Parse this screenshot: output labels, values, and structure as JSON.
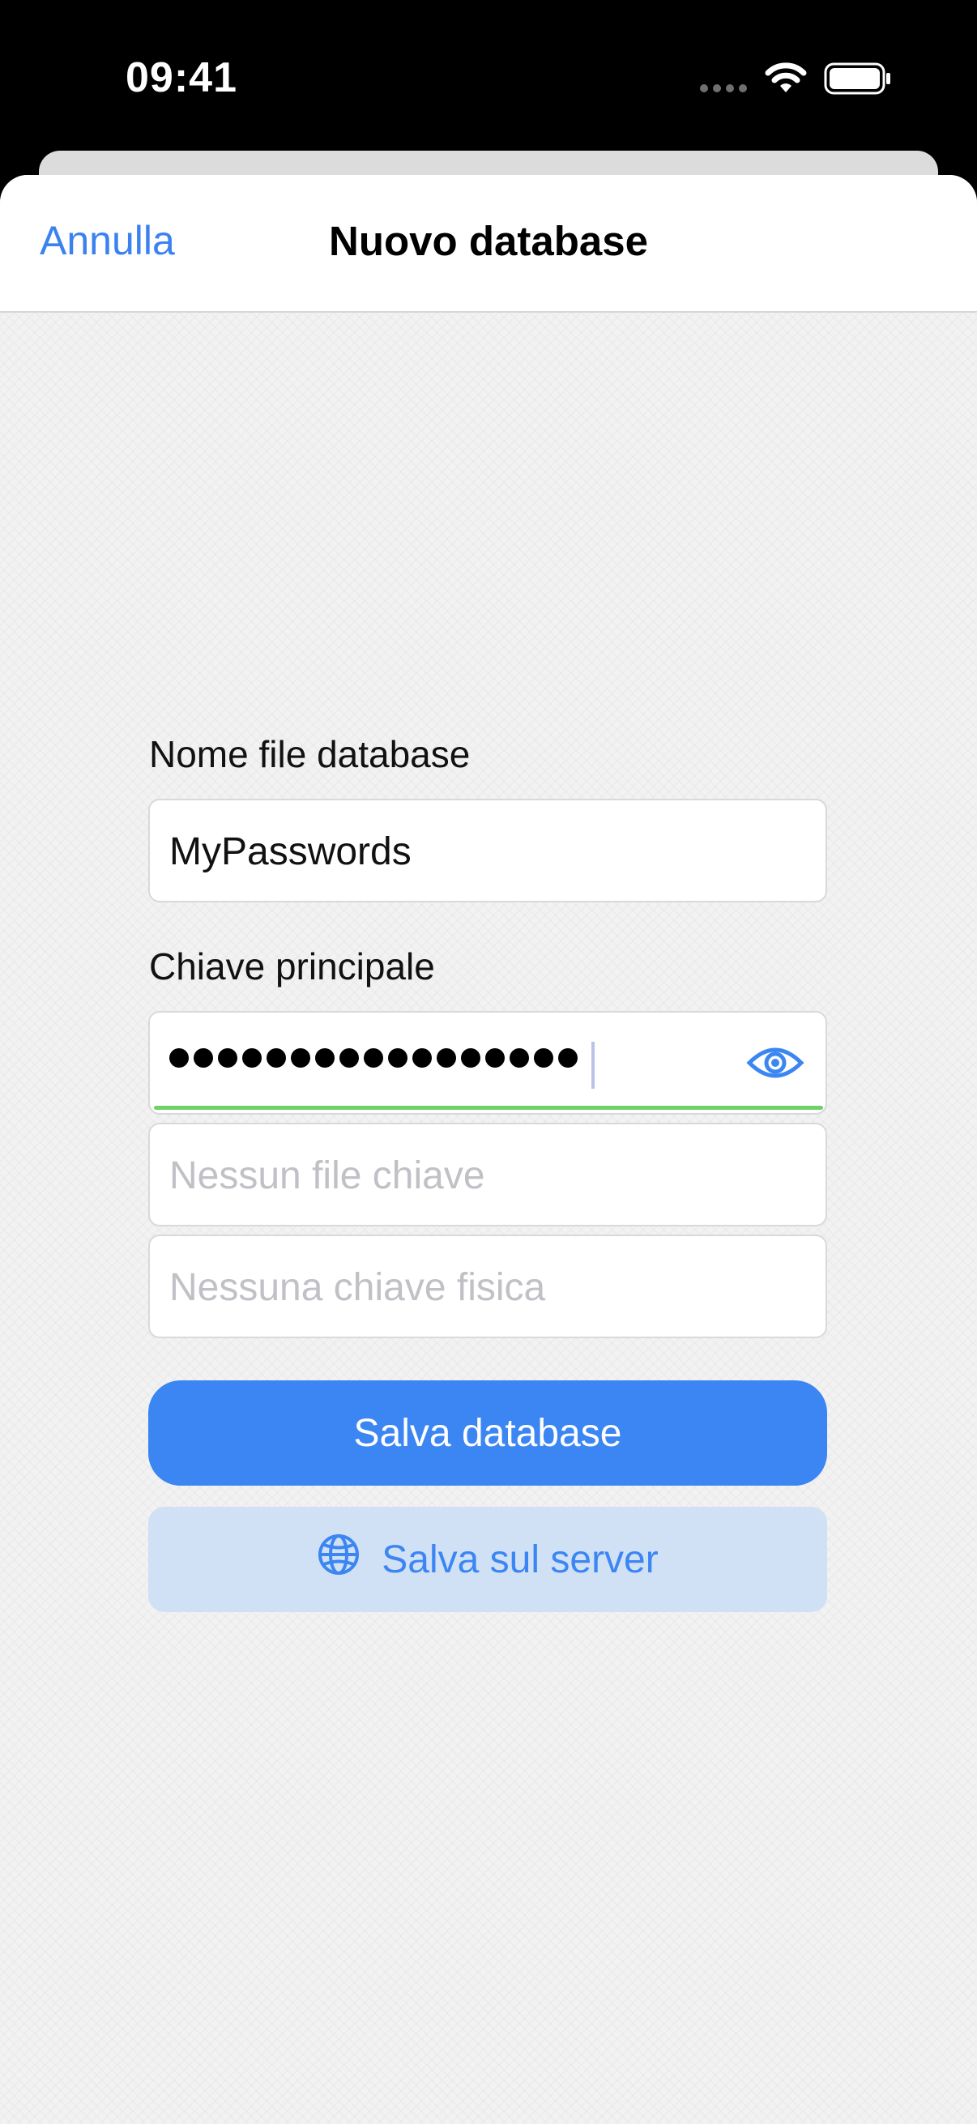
{
  "status_bar": {
    "time": "09:41"
  },
  "nav": {
    "cancel_label": "Annulla",
    "title": "Nuovo database"
  },
  "form": {
    "db_name_label": "Nome file database",
    "db_name_value": "MyPasswords",
    "master_key_label": "Chiave principale",
    "password_mask_count": 17,
    "keyfile_placeholder": "Nessun file chiave",
    "hardware_key_placeholder": "Nessuna chiave fisica",
    "password_strength_color": "#6fd168"
  },
  "actions": {
    "save_label": "Salva database",
    "server_label": "Salva sul server"
  },
  "icons": {
    "eye": "eye-icon",
    "globe": "globe-icon",
    "wifi": "wifi-icon",
    "battery": "battery-icon",
    "signal": "signal-icon"
  },
  "colors": {
    "accent": "#3b86f2",
    "secondary_button_bg": "#d0e0f5"
  }
}
